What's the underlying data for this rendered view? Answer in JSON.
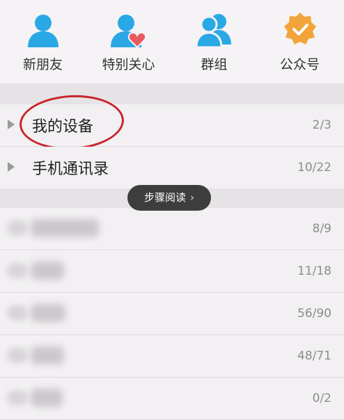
{
  "top_nav": {
    "items": [
      {
        "label": "新朋友",
        "icon": "person-icon"
      },
      {
        "label": "特别关心",
        "icon": "person-heart-icon"
      },
      {
        "label": "群组",
        "icon": "group-icon"
      },
      {
        "label": "公众号",
        "icon": "verified-badge-icon"
      }
    ]
  },
  "groups": [
    {
      "name": "我的设备",
      "count": "2/3"
    },
    {
      "name": "手机通讯录",
      "count": "10/22"
    }
  ],
  "toast": {
    "label": "步骤阅读"
  },
  "blurred_groups": [
    {
      "count": "8/9"
    },
    {
      "count": "11/18"
    },
    {
      "count": "56/90"
    },
    {
      "count": "48/71"
    },
    {
      "count": "0/2"
    }
  ],
  "colors": {
    "icon_blue": "#2aa8e6",
    "heart_red": "#e95a5e",
    "badge_orange": "#f2a43a",
    "annotation_red": "#c9252b"
  }
}
